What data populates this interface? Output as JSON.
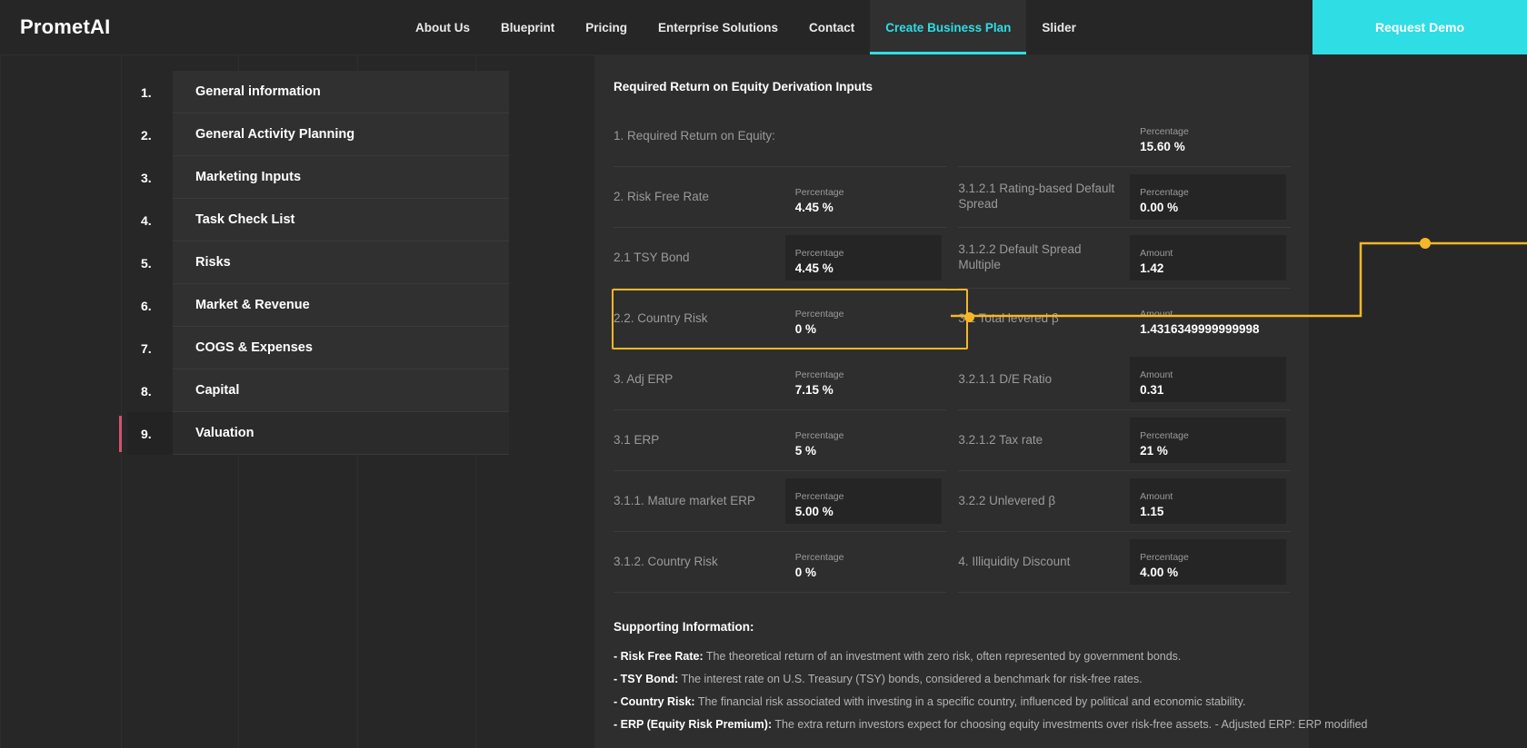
{
  "brand": "PrometAI",
  "nav": {
    "links": [
      {
        "label": "About Us",
        "active": false
      },
      {
        "label": "Blueprint",
        "active": false
      },
      {
        "label": "Pricing",
        "active": false
      },
      {
        "label": "Enterprise Solutions",
        "active": false
      },
      {
        "label": "Contact",
        "active": false
      },
      {
        "label": "Create Business Plan",
        "active": true
      },
      {
        "label": "Slider",
        "active": false
      }
    ],
    "cta": "Request Demo",
    "accent_color": "#2fdde4"
  },
  "sidebar": {
    "items": [
      {
        "num": "1.",
        "label": "General information",
        "active": false
      },
      {
        "num": "2.",
        "label": "General Activity Planning",
        "active": false
      },
      {
        "num": "3.",
        "label": "Marketing Inputs",
        "active": false
      },
      {
        "num": "4.",
        "label": "Task Check List",
        "active": false
      },
      {
        "num": "5.",
        "label": "Risks",
        "active": false
      },
      {
        "num": "6.",
        "label": "Market & Revenue",
        "active": false
      },
      {
        "num": "7.",
        "label": "COGS & Expenses",
        "active": false
      },
      {
        "num": "8.",
        "label": "Capital",
        "active": false
      },
      {
        "num": "9.",
        "label": "Valuation",
        "active": true
      }
    ],
    "active_marker_color": "#d4526e"
  },
  "panel": {
    "title": "Required Return on Equity Derivation Inputs",
    "highlight_color": "#f5b728",
    "rows": [
      {
        "left": {
          "label": "1. Required Return on Equity:",
          "field": null
        },
        "right": {
          "label": "",
          "field": {
            "caption": "Percentage",
            "value": "15.60 %",
            "boxed": false
          }
        }
      },
      {
        "left": {
          "label": "2. Risk Free Rate",
          "field": {
            "caption": "Percentage",
            "value": "4.45 %",
            "boxed": false
          }
        },
        "right": {
          "label": "3.1.2.1 Rating-based Default Spread",
          "field": {
            "caption": "Percentage",
            "value": "0.00 %",
            "boxed": true
          }
        }
      },
      {
        "left": {
          "label": "2.1 TSY Bond",
          "field": {
            "caption": "Percentage",
            "value": "4.45 %",
            "boxed": true
          }
        },
        "right": {
          "label": "3.1.2.2 Default Spread Multiple",
          "field": {
            "caption": "Amount",
            "value": "1.42",
            "boxed": true
          }
        }
      },
      {
        "highlighted": true,
        "left": {
          "label": "2.2. Country Risk",
          "field": {
            "caption": "Percentage",
            "value": "0 %",
            "boxed": false
          }
        },
        "right": {
          "label": "3.2 Total levered β",
          "field": {
            "caption": "Amount",
            "value": "1.4316349999999998",
            "boxed": false
          }
        }
      },
      {
        "left": {
          "label": "3. Adj ERP",
          "field": {
            "caption": "Percentage",
            "value": "7.15 %",
            "boxed": false
          }
        },
        "right": {
          "label": "3.2.1.1 D/E Ratio",
          "field": {
            "caption": "Amount",
            "value": "0.31",
            "boxed": true
          }
        }
      },
      {
        "left": {
          "label": "3.1 ERP",
          "field": {
            "caption": "Percentage",
            "value": "5 %",
            "boxed": false
          }
        },
        "right": {
          "label": "3.2.1.2 Tax rate",
          "field": {
            "caption": "Percentage",
            "value": "21 %",
            "boxed": true
          }
        }
      },
      {
        "left": {
          "label": "3.1.1. Mature market ERP",
          "field": {
            "caption": "Percentage",
            "value": "5.00 %",
            "boxed": true
          }
        },
        "right": {
          "label": "3.2.2 Unlevered β",
          "field": {
            "caption": "Amount",
            "value": "1.15",
            "boxed": true
          }
        }
      },
      {
        "left": {
          "label": "3.1.2. Country Risk",
          "field": {
            "caption": "Percentage",
            "value": "0 %",
            "boxed": false
          }
        },
        "right": {
          "label": "4. Illiquidity Discount",
          "field": {
            "caption": "Percentage",
            "value": "4.00 %",
            "boxed": true
          }
        }
      }
    ]
  },
  "support": {
    "title": "Supporting Information:",
    "lines": [
      {
        "term": "- Risk Free Rate:",
        "text": " The theoretical return of an investment with zero risk, often represented by government bonds."
      },
      {
        "term": "- TSY Bond:",
        "text": " The interest rate on U.S. Treasury (TSY) bonds, considered a benchmark for risk-free rates."
      },
      {
        "term": "- Country Risk:",
        "text": " The financial risk associated with investing in a specific country, influenced by political and economic stability."
      },
      {
        "term": "- ERP (Equity Risk Premium):",
        "text": " The extra return investors expect for choosing equity investments over risk-free assets. - Adjusted ERP: ERP modified"
      }
    ]
  }
}
